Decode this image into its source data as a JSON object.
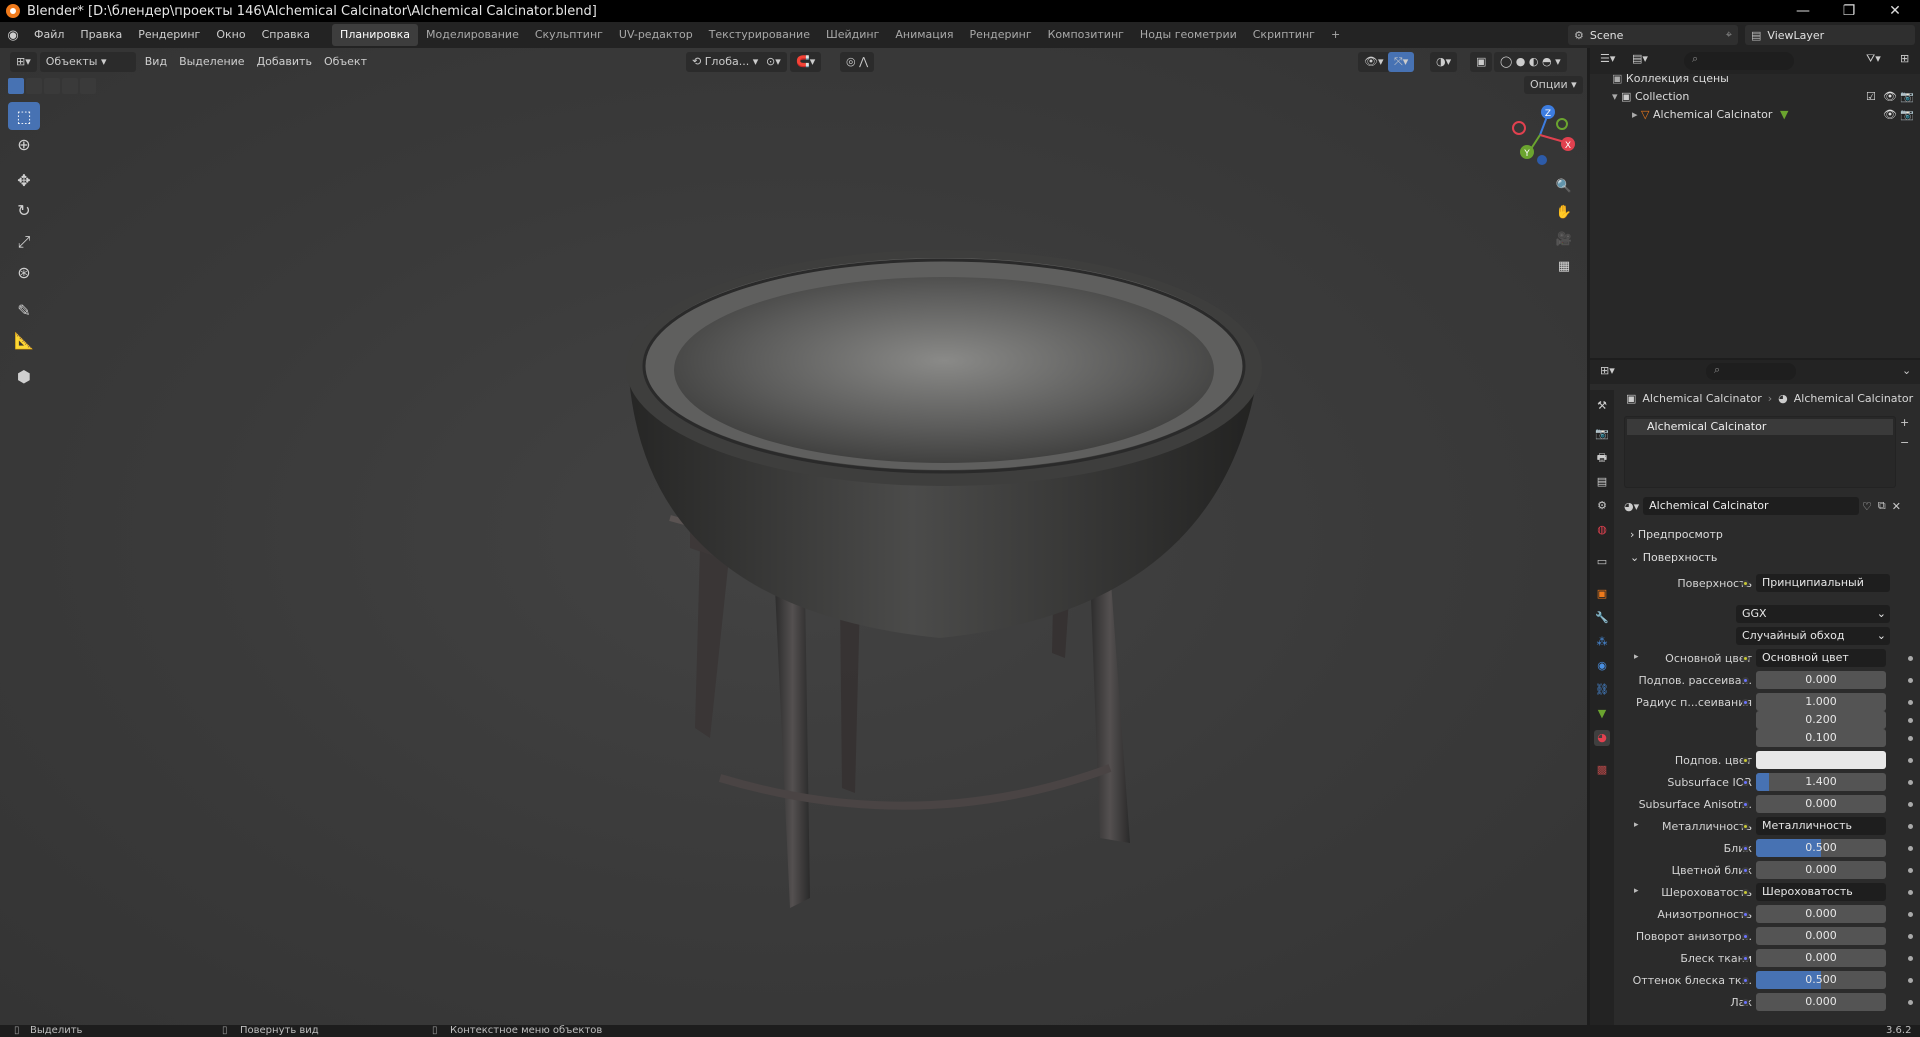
{
  "window": {
    "title": "Blender* [D:\\блендер\\проекты 146\\Alchemical Calcinator\\Alchemical Calcinator.blend]",
    "controls": [
      "—",
      "❐",
      "✕"
    ]
  },
  "menubar": {
    "menus": [
      "Файл",
      "Правка",
      "Рендеринг",
      "Окно",
      "Справка"
    ],
    "workspaces": [
      "Планировка",
      "Моделирование",
      "Скульптинг",
      "UV-редактор",
      "Текстурирование",
      "Шейдинг",
      "Анимация",
      "Рендеринг",
      "Композитинг",
      "Ноды геометрии",
      "Скриптинг"
    ],
    "active_workspace_index": 0,
    "add_tab": "+",
    "scene": "Scene",
    "view_layer": "ViewLayer"
  },
  "viewport_header": {
    "mode": "Объекты",
    "menus": [
      "Вид",
      "Выделение",
      "Добавить",
      "Объект"
    ],
    "transform_orientation": "Глоба...",
    "options_label": "Опции"
  },
  "toolbar": {
    "tools": [
      "select-box-icon",
      "cursor-icon",
      "move-icon",
      "rotate-icon",
      "scale-icon",
      "transform-icon",
      "annotate-icon",
      "measure-icon",
      "add-cube-icon"
    ],
    "active_tool_index": 0
  },
  "gizmo": {
    "axes": [
      "Z",
      "X",
      "Y"
    ]
  },
  "outliner": {
    "scene_collection": "Коллекция сцены",
    "collection": "Collection",
    "object": "Alchemical Calcinator"
  },
  "properties": {
    "breadcrumb_object": "Alchemical Calcinator",
    "breadcrumb_material": "Alchemical Calcinator",
    "slot_name": "Alchemical Calcinator",
    "material_name": "Alchemical Calcinator",
    "panel_preview": "Предпросмотр",
    "panel_surface": "Поверхность",
    "surface_label": "Поверхность",
    "surface_value": "Принципиальный BSDF",
    "distribution": "GGX",
    "subsurface_method": "Случайный обход",
    "rows": [
      {
        "label": "Основной цвет",
        "value": "Основной цвет",
        "kind": "link",
        "expand": true
      },
      {
        "label": "Подпов. рассеива...",
        "value": "0.000",
        "kind": "num",
        "fill": 0
      },
      {
        "label": "Радиус п...сеивания",
        "value": "1.000",
        "kind": "num",
        "fill": 0
      },
      {
        "label": "",
        "value": "0.200",
        "kind": "num",
        "fill": 0
      },
      {
        "label": "",
        "value": "0.100",
        "kind": "num",
        "fill": 0
      },
      {
        "label": "Подпов. цвет",
        "value": "",
        "kind": "color",
        "color": "#e8e8e8"
      },
      {
        "label": "Subsurface IOR",
        "value": "1.400",
        "kind": "num",
        "fill": 0.1
      },
      {
        "label": "Subsurface Anisotr...",
        "value": "0.000",
        "kind": "num",
        "fill": 0
      },
      {
        "label": "Металличность",
        "value": "Металличность",
        "kind": "link",
        "expand": true
      },
      {
        "label": "Блик",
        "value": "0.500",
        "kind": "num",
        "fill": 0.5
      },
      {
        "label": "Цветной блик",
        "value": "0.000",
        "kind": "num",
        "fill": 0
      },
      {
        "label": "Шероховатость",
        "value": "Шероховатость",
        "kind": "link",
        "expand": true
      },
      {
        "label": "Анизотропность",
        "value": "0.000",
        "kind": "num",
        "fill": 0
      },
      {
        "label": "Поворот анизотро...",
        "value": "0.000",
        "kind": "num",
        "fill": 0
      },
      {
        "label": "Блеск ткани",
        "value": "0.000",
        "kind": "num",
        "fill": 0
      },
      {
        "label": "Оттенок блеска тк...",
        "value": "0.500",
        "kind": "num",
        "fill": 0.5
      },
      {
        "label": "Лак",
        "value": "0.000",
        "kind": "num",
        "fill": 0
      }
    ]
  },
  "statusbar": {
    "select": "Выделить",
    "rotate_view": "Повернуть вид",
    "context_menu": "Контекстное меню объектов",
    "version": "3.6.2"
  },
  "colors": {
    "accent": "#4772b3",
    "blender_orange": "#ef7a1b",
    "axis_x": "#e1414f",
    "axis_y": "#6ba42f",
    "axis_z": "#3d7de0"
  }
}
